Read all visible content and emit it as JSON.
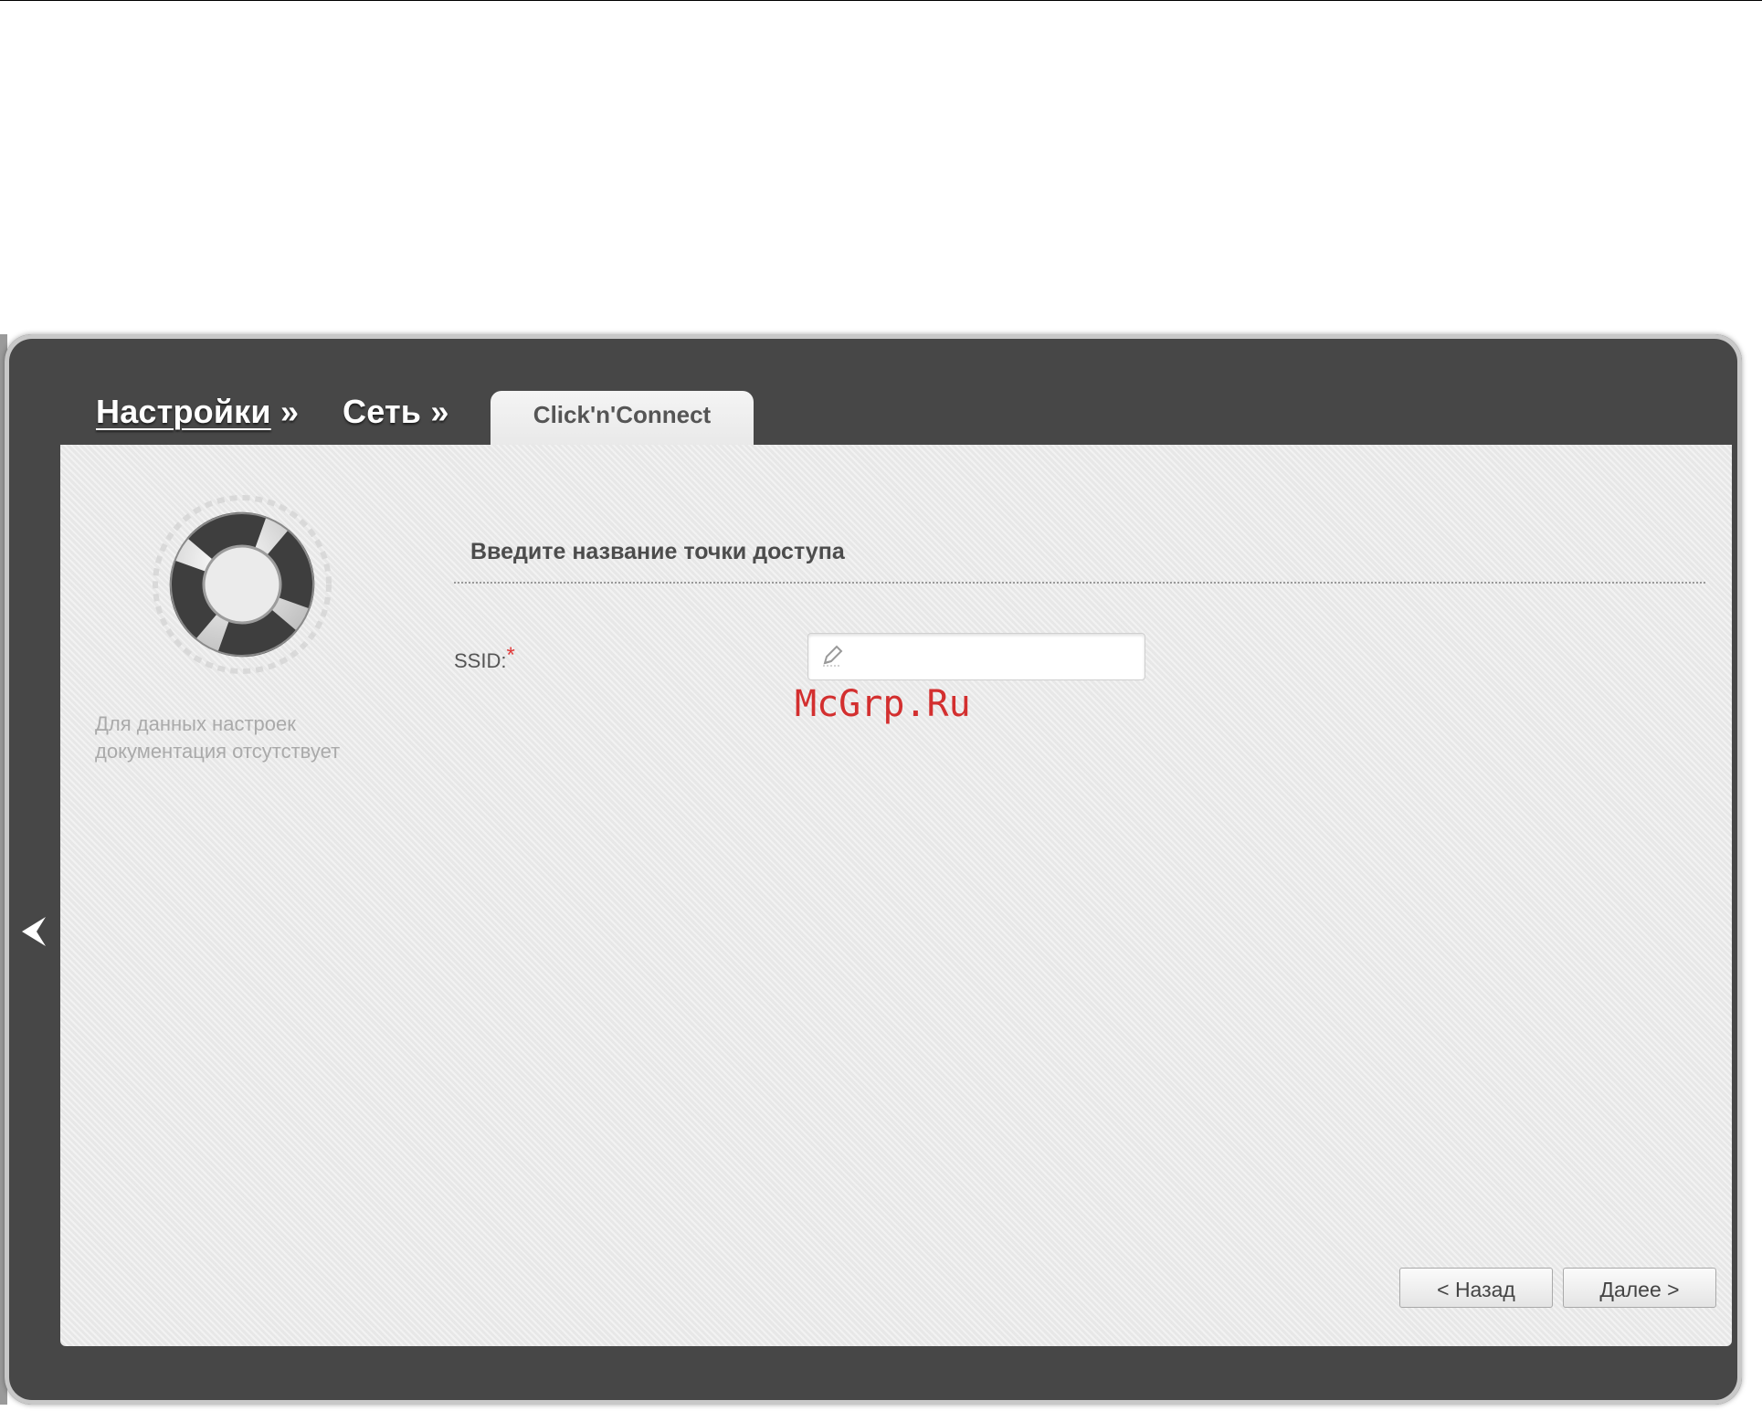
{
  "breadcrumb": {
    "items": [
      {
        "label": "Настройки",
        "separator": "»"
      },
      {
        "label": "Сеть",
        "separator": "»"
      }
    ]
  },
  "tab": {
    "label": "Click'n'Connect"
  },
  "help": {
    "text": "Для данных настроек документация отсутствует"
  },
  "form": {
    "title": "Введите название точки доступа",
    "ssid_label": "SSID:",
    "required_mark": "*",
    "ssid_value": ""
  },
  "buttons": {
    "back_label": "< Назад",
    "next_label": "Далее >"
  },
  "watermark": "McGrp.Ru",
  "colors": {
    "frame": "#474747",
    "panel": "#ebebeb",
    "required": "#e03a3a",
    "watermark": "#d32f2f"
  }
}
